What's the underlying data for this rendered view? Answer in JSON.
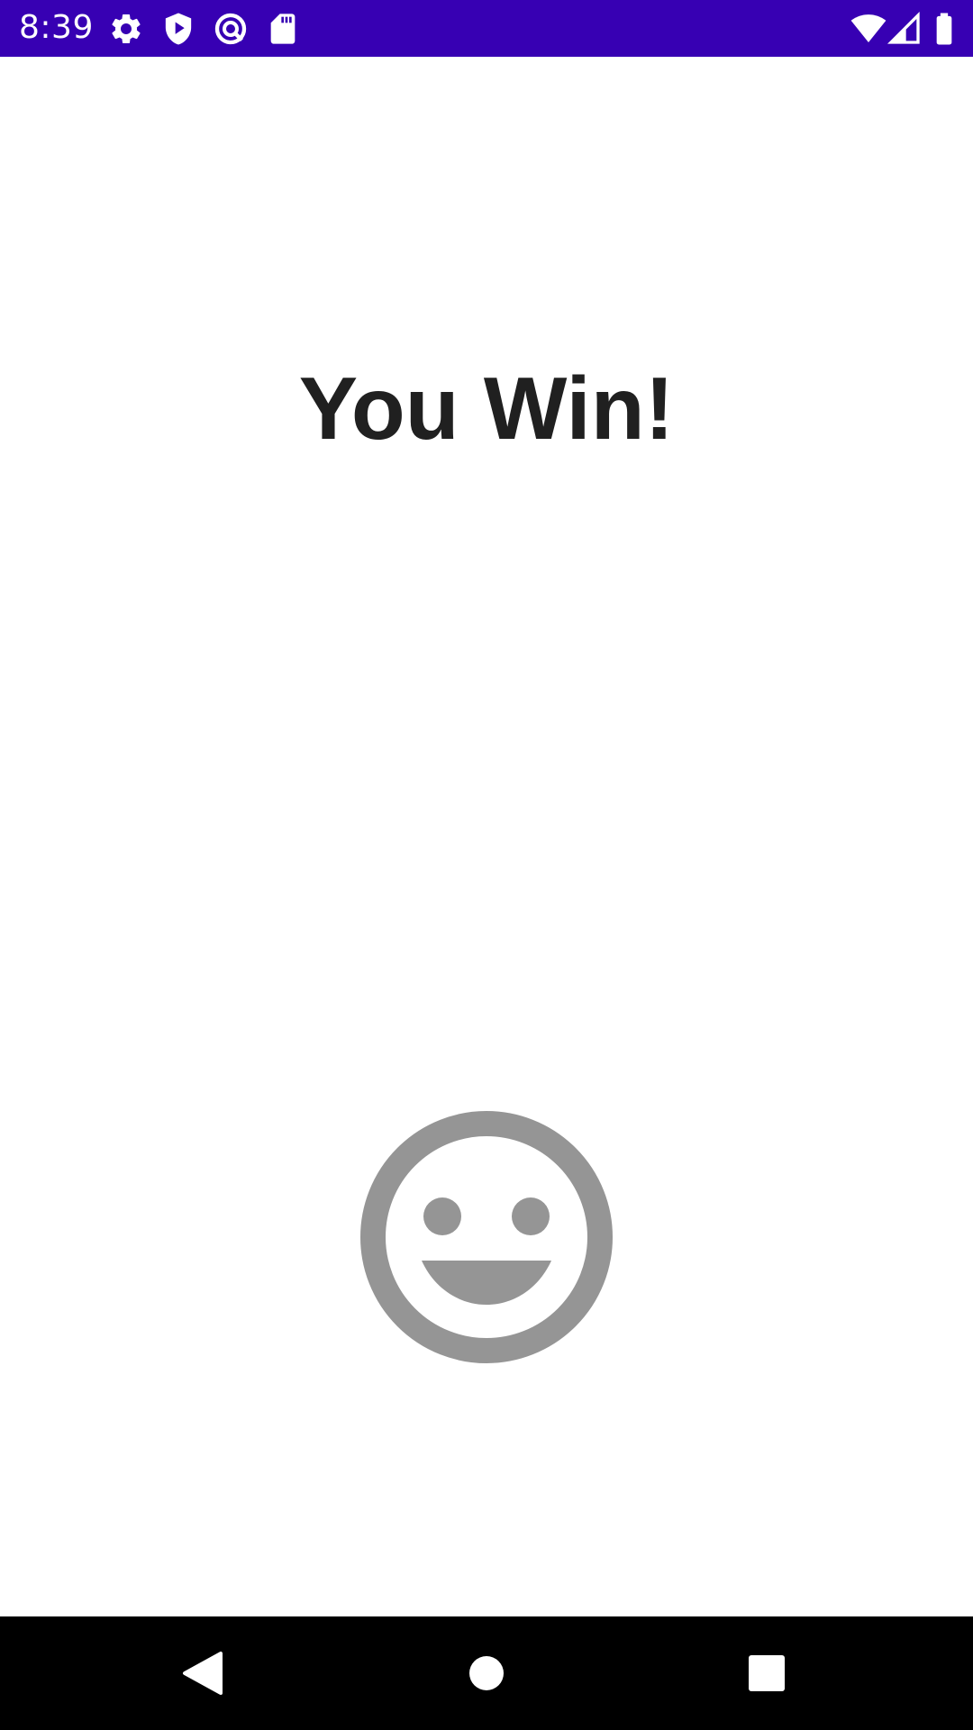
{
  "status_bar": {
    "time": "8:39",
    "background_color": "#3700b3",
    "left_icons": [
      "settings-gear-icon",
      "play-protect-icon",
      "sync-icon",
      "sd-card-icon"
    ],
    "right_icons": [
      "wifi-icon",
      "cell-signal-icon",
      "battery-icon"
    ]
  },
  "main": {
    "title": "You Win!",
    "emoji_icon": "smiley-face-icon",
    "emoji_color": "#959595"
  },
  "nav_bar": {
    "buttons": [
      "back-button",
      "home-button",
      "recents-button"
    ]
  }
}
